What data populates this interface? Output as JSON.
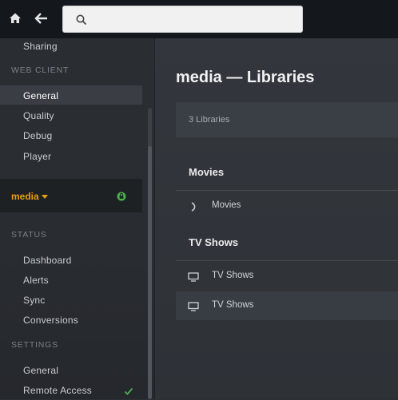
{
  "topbar": {
    "home_icon": "home-icon",
    "back_icon": "arrow-left-icon",
    "search": {
      "placeholder": "",
      "value": "",
      "icon": "search-icon"
    }
  },
  "sidebar": {
    "items_top": [
      {
        "label": "Sharing"
      }
    ],
    "web_client": {
      "header": "WEB CLIENT",
      "items": [
        {
          "label": "General",
          "active": true
        },
        {
          "label": "Quality"
        },
        {
          "label": "Debug"
        },
        {
          "label": "Player"
        }
      ]
    },
    "server": {
      "name": "media",
      "lock_icon": "lock-icon",
      "accent": "#e5a00d",
      "lock_color": "#4caf50"
    },
    "status": {
      "header": "STATUS",
      "items": [
        {
          "label": "Dashboard"
        },
        {
          "label": "Alerts"
        },
        {
          "label": "Sync"
        },
        {
          "label": "Conversions"
        }
      ]
    },
    "settings": {
      "header": "SETTINGS",
      "items": [
        {
          "label": "General"
        },
        {
          "label": "Remote Access",
          "status_icon": "check-icon",
          "status_color": "#4caf50"
        }
      ]
    }
  },
  "main": {
    "title": "media — Libraries",
    "count_text": "3 Libraries",
    "sections": [
      {
        "title": "Movies",
        "libraries": [
          {
            "label": "Movies",
            "icon": "spinner-icon"
          }
        ]
      },
      {
        "title": "TV Shows",
        "libraries": [
          {
            "label": "TV Shows",
            "icon": "monitor-icon"
          },
          {
            "label": "TV Shows",
            "icon": "monitor-icon"
          }
        ]
      }
    ]
  }
}
